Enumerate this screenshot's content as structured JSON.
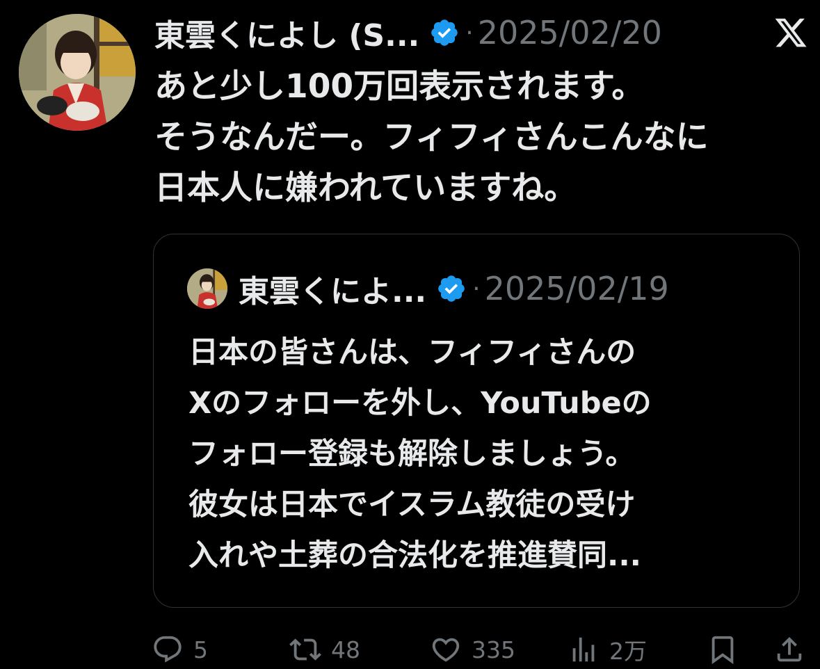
{
  "tweet": {
    "author_name": "東雲くによし (S...",
    "date": "2025/02/20",
    "separator": "·",
    "text": "あと少し100万回表示されます。\nそうなんだー。フィフィさんこんなに\n日本人に嫌われていますね。"
  },
  "quoted": {
    "author_name": "東雲くによ...",
    "date": "2025/02/19",
    "separator": "·",
    "text": "日本の皆さんは、フィフィさんの\nXのフォローを外し、YouTubeの\nフォロー登録も解除しましょう。\n彼女は日本でイスラム教徒の受け\n入れや土葬の合法化を推進賛同..."
  },
  "actions": {
    "replies": "5",
    "reposts": "48",
    "likes": "335",
    "views": "2万"
  },
  "icons": [
    "verified-icon",
    "x-logo-icon",
    "reply-icon",
    "repost-icon",
    "like-icon",
    "views-icon",
    "bookmark-icon",
    "share-icon"
  ],
  "colors": {
    "background": "#000000",
    "text": "#e7e9ea",
    "muted": "#71767b",
    "verified": "#1d9bf0",
    "border": "#2f3336"
  }
}
